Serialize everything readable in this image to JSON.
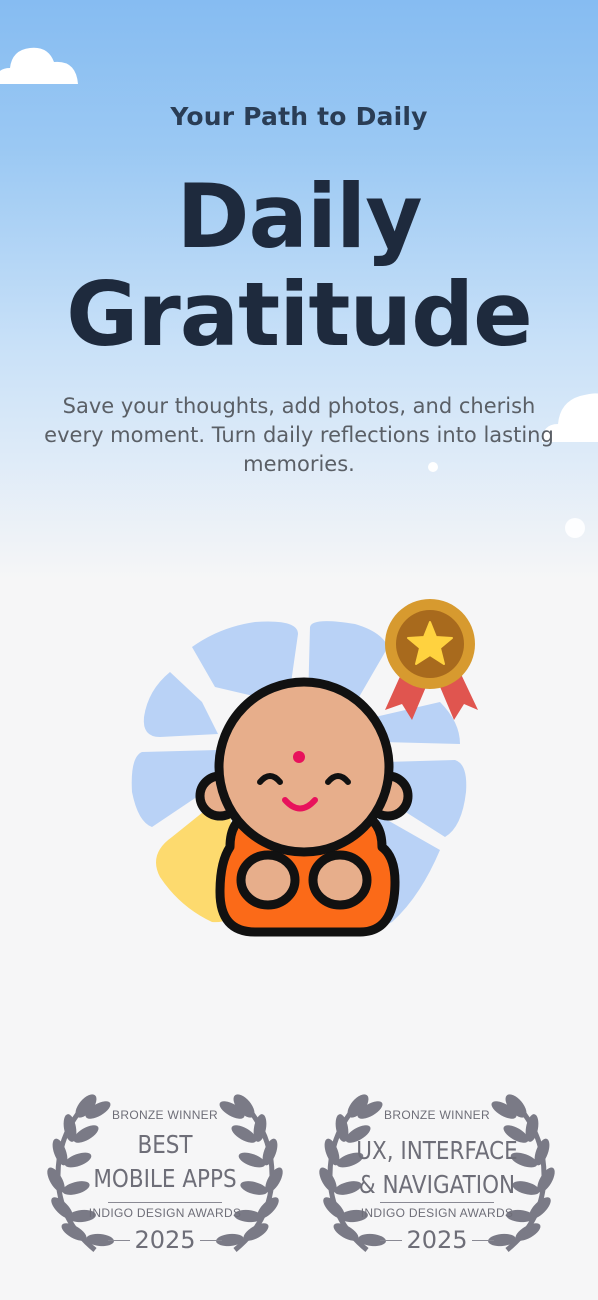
{
  "hero": {
    "subtitle": "Your Path to Daily",
    "title_line1": "Daily",
    "title_line2": "Gratitude",
    "description": "Save your thoughts, add photos, and cherish every moment. Turn daily reflections into lasting memories."
  },
  "illustration": {
    "icon": "smiling-monk-icon",
    "badge_icon": "medal-star-icon",
    "colors": {
      "petal": "#b9d2f6",
      "petal_accent": "#fdda6e",
      "robe": "#fb6a18",
      "skin": "#e7ae8b",
      "medal": "#d79a2f"
    }
  },
  "awards": [
    {
      "top_label": "BRONZE WINNER",
      "line1": "BEST",
      "line2": "MOBILE APPS",
      "organization": "INDIGO DESIGN AWARDS",
      "year": "2025"
    },
    {
      "top_label": "BRONZE WINNER",
      "line1": "UX, INTERFACE",
      "line2": "& NAVIGATION",
      "organization": "INDIGO DESIGN AWARDS",
      "year": "2025"
    }
  ]
}
